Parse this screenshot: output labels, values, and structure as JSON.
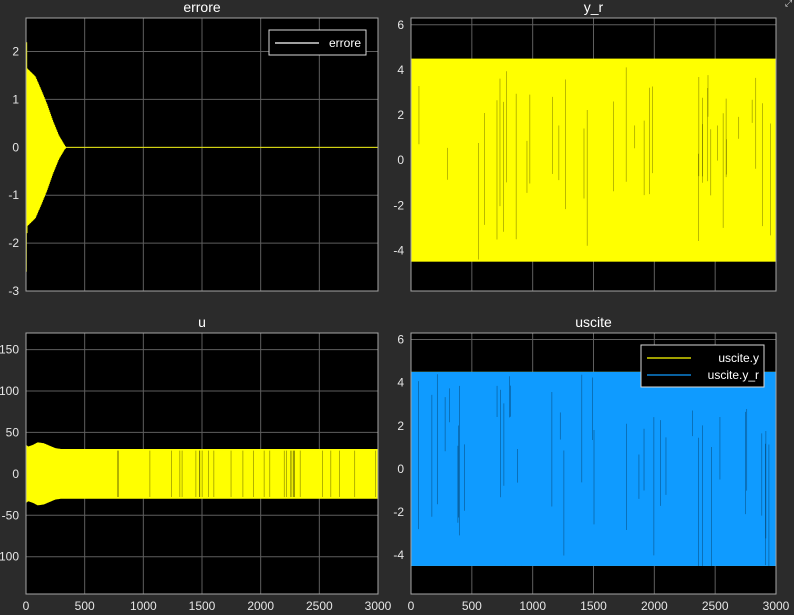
{
  "window": {
    "dock_icon": "undock-icon"
  },
  "theme": {
    "background": "#2b2b2b",
    "axes_background": "#000000",
    "grid": "#5e5e5e",
    "axes_border": "#a6a6a6",
    "text": "#ffffff",
    "tick_text": "#e6e6e6",
    "yellow": "#ffff00",
    "blue": "#0f9bff"
  },
  "chart_data": [
    {
      "type": "line",
      "title": "errore",
      "xlim": [
        0,
        3000
      ],
      "ylim": [
        -3,
        2.7
      ],
      "yticks": [
        -3,
        -2,
        -1,
        0,
        1,
        2
      ],
      "xticks": [
        0,
        500,
        1000,
        1500,
        2000,
        2500,
        3000
      ],
      "show_xticklabels": false,
      "grid": true,
      "legend": {
        "placement": "top-right",
        "entries": [
          {
            "label": "errore",
            "color": "#ffffff"
          }
        ]
      },
      "series": [
        {
          "name": "errore",
          "color": "#ffff00",
          "kind": "oscillation",
          "envelope": {
            "x": [
              0,
              10,
              30,
              80,
              130,
              180,
              230,
              280,
              340,
              3000
            ],
            "y": [
              3.0,
              1.65,
              1.6,
              1.48,
              1.2,
              0.9,
              0.55,
              0.25,
              0.0,
              0.0
            ]
          }
        }
      ]
    },
    {
      "type": "line",
      "title": "y_r",
      "xlim": [
        0,
        3000
      ],
      "ylim": [
        -5.8,
        6.3
      ],
      "yticks": [
        -4,
        -2,
        0,
        2,
        4,
        6
      ],
      "xticks": [
        0,
        500,
        1000,
        1500,
        2000,
        2500,
        3000
      ],
      "show_xticklabels": false,
      "grid": true,
      "series": [
        {
          "name": "y_r",
          "color": "#ffff00",
          "kind": "band",
          "ymin": -4.5,
          "ymax": 4.5
        }
      ]
    },
    {
      "type": "line",
      "title": "u",
      "xlim": [
        0,
        3000
      ],
      "ylim": [
        -145,
        170
      ],
      "yticks": [
        -100,
        -50,
        0,
        50,
        100,
        150
      ],
      "yticklabels": [
        "100",
        "-50",
        "0",
        "50",
        "100",
        "150"
      ],
      "xticks": [
        0,
        500,
        1000,
        1500,
        2000,
        2500,
        3000
      ],
      "show_xticklabels": true,
      "grid": true,
      "series": [
        {
          "name": "u",
          "color": "#ffff00",
          "kind": "oscillation",
          "envelope": {
            "x": [
              0,
              20,
              60,
              100,
              150,
              200,
              250,
              300,
              3000
            ],
            "y": [
              35,
              33,
              35,
              38,
              37,
              34,
              31,
              30,
              30
            ]
          }
        }
      ]
    },
    {
      "type": "line",
      "title": "uscite",
      "xlim": [
        0,
        3000
      ],
      "ylim": [
        -5.8,
        6.3
      ],
      "yticks": [
        -4,
        -2,
        0,
        2,
        4,
        6
      ],
      "xticks": [
        0,
        500,
        1000,
        1500,
        2000,
        2500,
        3000
      ],
      "show_xticklabels": true,
      "grid": true,
      "legend": {
        "placement": "top-right",
        "entries": [
          {
            "label": "uscite.y",
            "color": "#ffff00"
          },
          {
            "label": "uscite.y_r",
            "color": "#0f9bff"
          }
        ]
      },
      "series": [
        {
          "name": "uscite.y",
          "color": "#ffff00",
          "kind": "band",
          "ymin": -4.5,
          "ymax": 4.5
        },
        {
          "name": "uscite.y_r",
          "color": "#0f9bff",
          "kind": "band",
          "ymin": -4.5,
          "ymax": 4.5
        }
      ]
    }
  ]
}
